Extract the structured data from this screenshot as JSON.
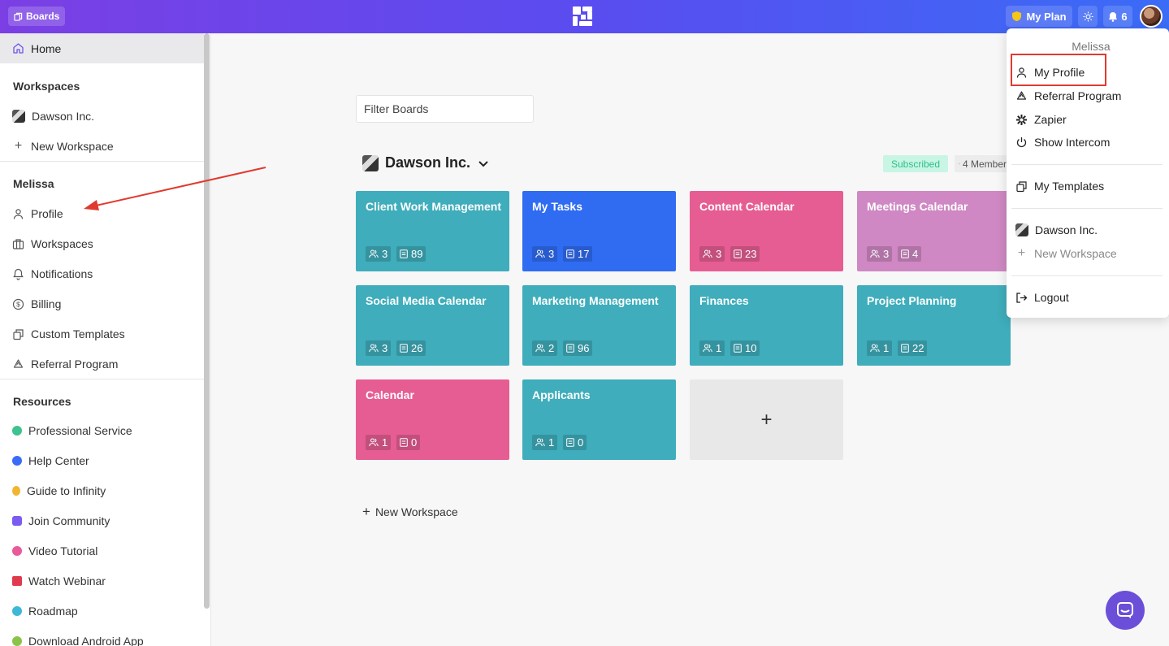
{
  "topbar": {
    "boards_label": "Boards",
    "myplan_label": "My Plan",
    "notification_count": "6",
    "brand_gradient": [
      "#7b3fe4",
      "#3a6cf6"
    ]
  },
  "sidebar": {
    "home": "Home",
    "workspaces_heading": "Workspaces",
    "workspace_items": [
      "Dawson Inc.",
      "New Workspace"
    ],
    "user_heading": "Melissa",
    "user_items": [
      "Profile",
      "Workspaces",
      "Notifications",
      "Billing",
      "Custom Templates",
      "Referral Program"
    ],
    "resources_heading": "Resources",
    "resource_items": [
      {
        "label": "Professional Service",
        "color": "#3ec28f"
      },
      {
        "label": "Help Center",
        "color": "#3a6cf6"
      },
      {
        "label": "Guide to Infinity",
        "color": "#f2b531"
      },
      {
        "label": "Join Community",
        "color": "#7b5cf0"
      },
      {
        "label": "Video Tutorial",
        "color": "#e85a9a"
      },
      {
        "label": "Watch Webinar",
        "color": "#e03a4f"
      },
      {
        "label": "Roadmap",
        "color": "#3fb8d8"
      },
      {
        "label": "Download Android App",
        "color": "#8bc34a"
      }
    ]
  },
  "main": {
    "filter_placeholder": "Filter Boards",
    "workspace_name": "Dawson Inc.",
    "subscribed_badge": "Subscribed",
    "members_badge": "4 Members",
    "boards": [
      {
        "title": "Client Work Management",
        "members": "3",
        "items": "89",
        "color": "#3fadbb"
      },
      {
        "title": "My Tasks",
        "members": "3",
        "items": "17",
        "color": "#2f6cf2"
      },
      {
        "title": "Content Calendar",
        "members": "3",
        "items": "23",
        "color": "#e65d93"
      },
      {
        "title": "Meetings Calendar",
        "members": "3",
        "items": "4",
        "color": "#cf88c3"
      },
      {
        "title": "Social Media Calendar",
        "members": "3",
        "items": "26",
        "color": "#3fadbb"
      },
      {
        "title": "Marketing Management",
        "members": "2",
        "items": "96",
        "color": "#3fadbb"
      },
      {
        "title": "Finances",
        "members": "1",
        "items": "10",
        "color": "#3fadbb"
      },
      {
        "title": "Project Planning",
        "members": "1",
        "items": "22",
        "color": "#3fadbb"
      },
      {
        "title": "Calendar",
        "members": "1",
        "items": "0",
        "color": "#e65d93"
      },
      {
        "title": "Applicants",
        "members": "1",
        "items": "0",
        "color": "#3fadbb"
      }
    ],
    "add_board_symbol": "+",
    "new_workspace": "New Workspace"
  },
  "dropdown": {
    "user_name": "Melissa",
    "items": [
      "My Profile",
      "Referral Program",
      "Zapier",
      "Show Intercom"
    ],
    "templates": "My Templates",
    "workspace": "Dawson Inc.",
    "new_workspace": "New Workspace",
    "logout": "Logout"
  },
  "annotation_color": "#e03a2f"
}
